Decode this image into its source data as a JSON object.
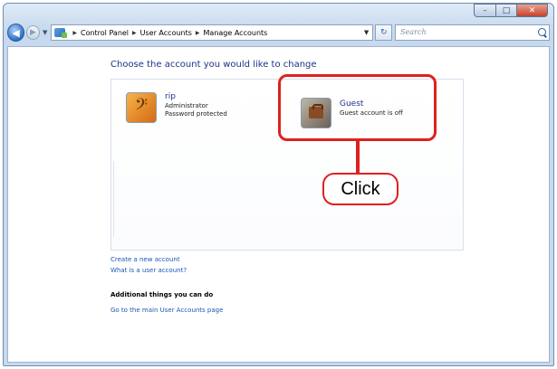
{
  "window": {
    "minimize_glyph": "–",
    "maximize_glyph": "□",
    "close_glyph": "✕"
  },
  "address_bar": {
    "breadcrumbs": [
      "Control Panel",
      "User Accounts",
      "Manage Accounts"
    ],
    "search_placeholder": "Search"
  },
  "main": {
    "heading": "Choose the account you would like to change",
    "accounts": [
      {
        "name": "rip",
        "role": "Administrator",
        "status": "Password protected",
        "picture_icon": "bass-clef-icon"
      },
      {
        "name": "Guest",
        "status": "Guest account is off",
        "picture_icon": "briefcase-icon"
      }
    ],
    "links": [
      "Create a new account",
      "What is a user account?"
    ],
    "additional_title": "Additional things you can do",
    "additional_links": [
      "Go to the main User Accounts page"
    ]
  },
  "annotation": {
    "callout_text": "Click",
    "color": "#e02020"
  },
  "colors": {
    "heading": "#1e3287",
    "link": "#1a56b8"
  }
}
